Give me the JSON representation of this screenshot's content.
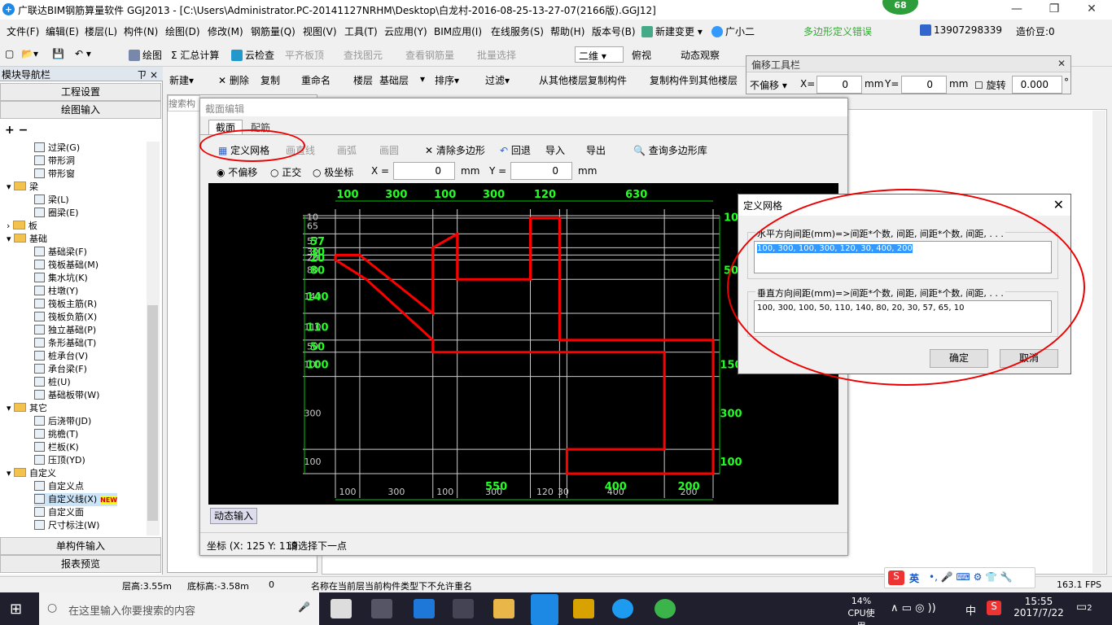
{
  "app": {
    "title": "广联达BIM钢筋算量软件 GGJ2013 - [C:\\Users\\Administrator.PC-20141127NRHM\\Desktop\\白龙村-2016-08-25-13-27-07(2166版).GGJ12]",
    "badge": "68",
    "icon": "+"
  },
  "menu": [
    "文件(F)",
    "编辑(E)",
    "楼层(L)",
    "构件(N)",
    "绘图(D)",
    "修改(M)",
    "钢筋量(Q)",
    "视图(V)",
    "工具(T)",
    "云应用(Y)",
    "BIM应用(I)",
    "在线服务(S)",
    "帮助(H)",
    "版本号(B)",
    "新建变更 ▾",
    "广小二"
  ],
  "menu_right": {
    "error": "多边形定义错误",
    "phone": "13907298339",
    "beans": "造价豆:0"
  },
  "toolbar1": [
    "绘图",
    "Σ 汇总计算",
    "云检查",
    "平齐板顶",
    "查找图元",
    "查看钢筋量",
    "批量选择",
    "二维",
    "俯视",
    "动态观察"
  ],
  "nav": {
    "header": "模块导航栏",
    "pin": "ㄗ ×",
    "btn_project": "工程设置",
    "btn_draw": "绘图输入",
    "btn_single": "单构件输入",
    "btn_report": "报表预览",
    "search_placeholder": "搜索构"
  },
  "tree": [
    {
      "label": "过梁(G)",
      "lvl": 2,
      "t": "i"
    },
    {
      "label": "带形洞",
      "lvl": 2,
      "t": "i"
    },
    {
      "label": "带形窗",
      "lvl": 2,
      "t": "i"
    },
    {
      "label": "梁",
      "lvl": 1,
      "t": "f",
      "exp": "▾"
    },
    {
      "label": "梁(L)",
      "lvl": 2,
      "t": "i"
    },
    {
      "label": "圈梁(E)",
      "lvl": 2,
      "t": "i"
    },
    {
      "label": "板",
      "lvl": 1,
      "t": "f",
      "exp": "›"
    },
    {
      "label": "基础",
      "lvl": 1,
      "t": "f",
      "exp": "▾"
    },
    {
      "label": "基础梁(F)",
      "lvl": 2,
      "t": "i"
    },
    {
      "label": "筏板基础(M)",
      "lvl": 2,
      "t": "i"
    },
    {
      "label": "集水坑(K)",
      "lvl": 2,
      "t": "i"
    },
    {
      "label": "柱墩(Y)",
      "lvl": 2,
      "t": "i"
    },
    {
      "label": "筏板主筋(R)",
      "lvl": 2,
      "t": "i"
    },
    {
      "label": "筏板负筋(X)",
      "lvl": 2,
      "t": "i"
    },
    {
      "label": "独立基础(P)",
      "lvl": 2,
      "t": "i"
    },
    {
      "label": "条形基础(T)",
      "lvl": 2,
      "t": "i"
    },
    {
      "label": "桩承台(V)",
      "lvl": 2,
      "t": "i"
    },
    {
      "label": "承台梁(F)",
      "lvl": 2,
      "t": "i"
    },
    {
      "label": "桩(U)",
      "lvl": 2,
      "t": "i"
    },
    {
      "label": "基础板带(W)",
      "lvl": 2,
      "t": "i"
    },
    {
      "label": "其它",
      "lvl": 1,
      "t": "f",
      "exp": "▾"
    },
    {
      "label": "后浇带(JD)",
      "lvl": 2,
      "t": "i"
    },
    {
      "label": "挑檐(T)",
      "lvl": 2,
      "t": "i"
    },
    {
      "label": "栏板(K)",
      "lvl": 2,
      "t": "i"
    },
    {
      "label": "压顶(YD)",
      "lvl": 2,
      "t": "i"
    },
    {
      "label": "自定义",
      "lvl": 1,
      "t": "f",
      "exp": "▾"
    },
    {
      "label": "自定义点",
      "lvl": 2,
      "t": "i"
    },
    {
      "label": "自定义线(X)",
      "lvl": 2,
      "t": "i",
      "sel": true
    },
    {
      "label": "自定义面",
      "lvl": 2,
      "t": "i"
    },
    {
      "label": "尺寸标注(W)",
      "lvl": 2,
      "t": "i"
    }
  ],
  "new_tag": "NEW",
  "subtoolbar": [
    "新建▾",
    "删除",
    "复制",
    "重命名",
    "楼层",
    "基础层",
    "▾",
    "排序▾",
    "过滤▾",
    "从其他楼层复制构件",
    "复制构件到其他楼层"
  ],
  "section_dlg": {
    "title": "截面编辑",
    "tabs": [
      "截面",
      "配筋"
    ],
    "tools": [
      "定义网格",
      "画直线",
      "画弧",
      "画圆",
      "清除多边形",
      "回退",
      "导入",
      "导出",
      "查询多边形库"
    ],
    "modes": [
      "不偏移",
      "正交",
      "极坐标"
    ],
    "x_label": "X =",
    "x_val": "0",
    "y_label": "Y =",
    "y_val": "0",
    "unit": "mm",
    "dynamic": "动态输入",
    "coord": "坐标 (X: 125 Y: 119",
    "prompt": "请选择下一点"
  },
  "offset_bar": {
    "title": "偏移工具栏",
    "mode": "不偏移",
    "x_label": "X=",
    "x_val": "0",
    "y_label": "Y=",
    "y_val": "0",
    "unit": "mm",
    "rot_label": "旋转",
    "rot_val": "0.000",
    "deg": "°"
  },
  "grid_dlg": {
    "title": "定义网格",
    "h_label": "水平方向间距(mm)=>间距*个数, 间距, 间距*个数, 间距, . . .",
    "h_value": "100, 300, 100, 300, 120, 30, 400, 200",
    "v_label": "垂直方向间距(mm)=>间距*个数, 间距, 间距*个数, 间距, . . .",
    "v_value": "100, 300, 100, 50, 110, 140, 80, 20, 30, 57, 65, 10",
    "ok": "确定",
    "cancel": "取消"
  },
  "chart_data": {
    "type": "table",
    "top_labels": [
      "100",
      "300",
      "100",
      "300",
      "120",
      "630"
    ],
    "bottom_labels": [
      "100",
      "300",
      "100",
      "300",
      "120",
      "30",
      "400",
      "200"
    ],
    "bottom_green": [
      "550",
      "400",
      "200"
    ],
    "left_labels": [
      "10",
      "65",
      "57",
      "30",
      "20",
      "80",
      "140",
      "110",
      "50",
      "100",
      "300",
      "100"
    ],
    "left_green": [
      "57",
      "30",
      "20",
      "80",
      "140",
      "110",
      "50",
      "100"
    ],
    "right_labels": [
      "10",
      "50",
      "150",
      "300",
      "100"
    ],
    "x_spacing": [
      100,
      300,
      100,
      300,
      120,
      30,
      400,
      200
    ],
    "y_spacing": [
      10,
      65,
      57,
      30,
      20,
      80,
      140,
      110,
      50,
      100,
      300,
      100
    ],
    "polygon": [
      [
        0,
        290
      ],
      [
        100,
        290
      ],
      [
        400,
        50
      ],
      [
        400,
        280
      ],
      [
        500,
        280
      ],
      [
        500,
        420
      ],
      [
        100,
        420
      ],
      [
        0,
        330
      ]
    ],
    "polygon_units": "mm"
  },
  "status": {
    "floor_h": "层高:3.55m",
    "base_h": "底标高:-3.58m",
    "zero": "0",
    "msg": "名称在当前层当前构件类型下不允许重名",
    "fps": "163.1 FPS"
  },
  "ime": {
    "en": "英"
  },
  "taskbar": {
    "search": "在这里输入你要搜索的内容",
    "cpu": "14%",
    "cpu_label": "CPU使用",
    "lang": "中",
    "time": "15:55",
    "date": "2017/7/22",
    "notif": "2"
  }
}
